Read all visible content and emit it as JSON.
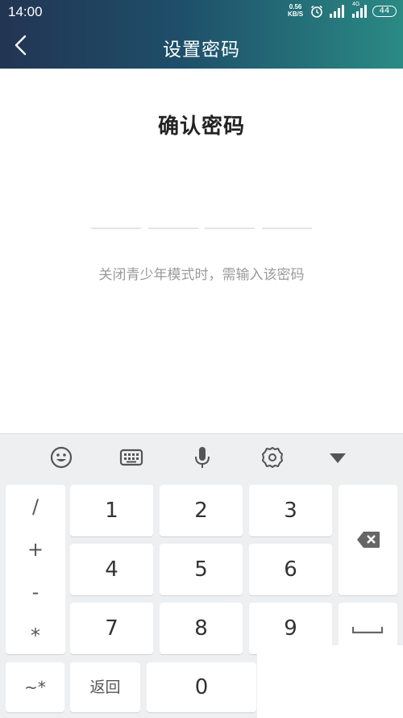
{
  "status_bar": {
    "time": "14:00",
    "speed_value": "0.56",
    "speed_unit": "KB/S",
    "network": "4G",
    "battery": "44"
  },
  "header": {
    "title": "设置密码"
  },
  "content": {
    "heading": "确认密码",
    "hint": "关闭青少年模式时，需输入该密码",
    "code_length": 4
  },
  "keyboard": {
    "toolbar_icons": [
      "emoji-icon",
      "keyboard-icon",
      "microphone-icon",
      "settings-icon",
      "collapse-icon"
    ],
    "symbols": [
      "/",
      "+",
      "-",
      "*"
    ],
    "digits": [
      "1",
      "2",
      "3",
      "4",
      "5",
      "6",
      "7",
      "8",
      "9"
    ],
    "zero": "0",
    "tilde_key": "~*",
    "return_key": "返回"
  }
}
